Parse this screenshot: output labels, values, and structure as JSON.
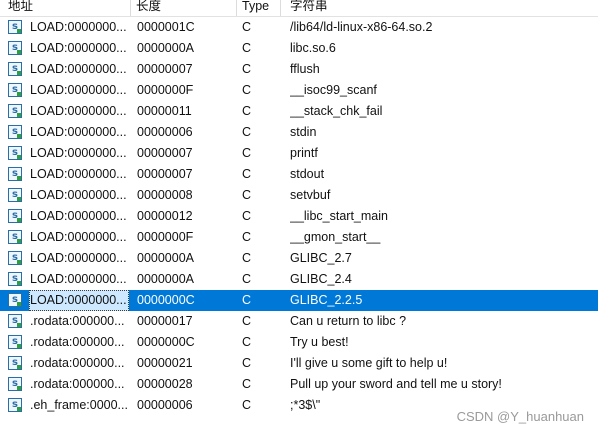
{
  "columns": {
    "address": "地址",
    "length": "长度",
    "type": "Type",
    "string": "字符串"
  },
  "rows": [
    {
      "address": "LOAD:0000000...",
      "length": "0000001C",
      "type": "C",
      "string": "/lib64/ld-linux-x86-64.so.2",
      "icon": "string-item-icon",
      "selected": false
    },
    {
      "address": "LOAD:0000000...",
      "length": "0000000A",
      "type": "C",
      "string": "libc.so.6",
      "icon": "string-item-icon",
      "selected": false
    },
    {
      "address": "LOAD:0000000...",
      "length": "00000007",
      "type": "C",
      "string": "fflush",
      "icon": "string-item-icon",
      "selected": false
    },
    {
      "address": "LOAD:0000000...",
      "length": "0000000F",
      "type": "C",
      "string": "__isoc99_scanf",
      "icon": "string-item-icon",
      "selected": false
    },
    {
      "address": "LOAD:0000000...",
      "length": "00000011",
      "type": "C",
      "string": "__stack_chk_fail",
      "icon": "string-item-icon",
      "selected": false
    },
    {
      "address": "LOAD:0000000...",
      "length": "00000006",
      "type": "C",
      "string": "stdin",
      "icon": "string-item-icon",
      "selected": false
    },
    {
      "address": "LOAD:0000000...",
      "length": "00000007",
      "type": "C",
      "string": "printf",
      "icon": "string-item-icon",
      "selected": false
    },
    {
      "address": "LOAD:0000000...",
      "length": "00000007",
      "type": "C",
      "string": "stdout",
      "icon": "string-item-icon",
      "selected": false
    },
    {
      "address": "LOAD:0000000...",
      "length": "00000008",
      "type": "C",
      "string": "setvbuf",
      "icon": "string-item-icon",
      "selected": false
    },
    {
      "address": "LOAD:0000000...",
      "length": "00000012",
      "type": "C",
      "string": "__libc_start_main",
      "icon": "string-item-icon",
      "selected": false
    },
    {
      "address": "LOAD:0000000...",
      "length": "0000000F",
      "type": "C",
      "string": "__gmon_start__",
      "icon": "string-item-icon",
      "selected": false
    },
    {
      "address": "LOAD:0000000...",
      "length": "0000000A",
      "type": "C",
      "string": "GLIBC_2.7",
      "icon": "string-item-icon",
      "selected": false
    },
    {
      "address": "LOAD:0000000...",
      "length": "0000000A",
      "type": "C",
      "string": "GLIBC_2.4",
      "icon": "string-item-icon",
      "selected": false
    },
    {
      "address": "LOAD:0000000...",
      "length": "0000000C",
      "type": "C",
      "string": "GLIBC_2.2.5",
      "icon": "string-item-icon",
      "selected": true
    },
    {
      "address": ".rodata:000000...",
      "length": "00000017",
      "type": "C",
      "string": "Can u return to libc ?",
      "icon": "string-item-icon",
      "selected": false
    },
    {
      "address": ".rodata:000000...",
      "length": "0000000C",
      "type": "C",
      "string": "Try u best!",
      "icon": "string-item-icon",
      "selected": false
    },
    {
      "address": ".rodata:000000...",
      "length": "00000021",
      "type": "C",
      "string": "I'll give u some gift to help u!",
      "icon": "string-item-icon",
      "selected": false
    },
    {
      "address": ".rodata:000000...",
      "length": "00000028",
      "type": "C",
      "string": "Pull up your sword and tell me u story!",
      "icon": "string-item-icon",
      "selected": false
    },
    {
      "address": ".eh_frame:0000...",
      "length": "00000006",
      "type": "C",
      "string": ";*3$\\\"",
      "icon": "string-item-icon",
      "selected": false
    }
  ],
  "watermark": "CSDN @Y_huanhuan",
  "colors": {
    "selection": "#0078d7",
    "icon_border": "#2b6ea6",
    "icon_dot": "#2e9e3e"
  }
}
